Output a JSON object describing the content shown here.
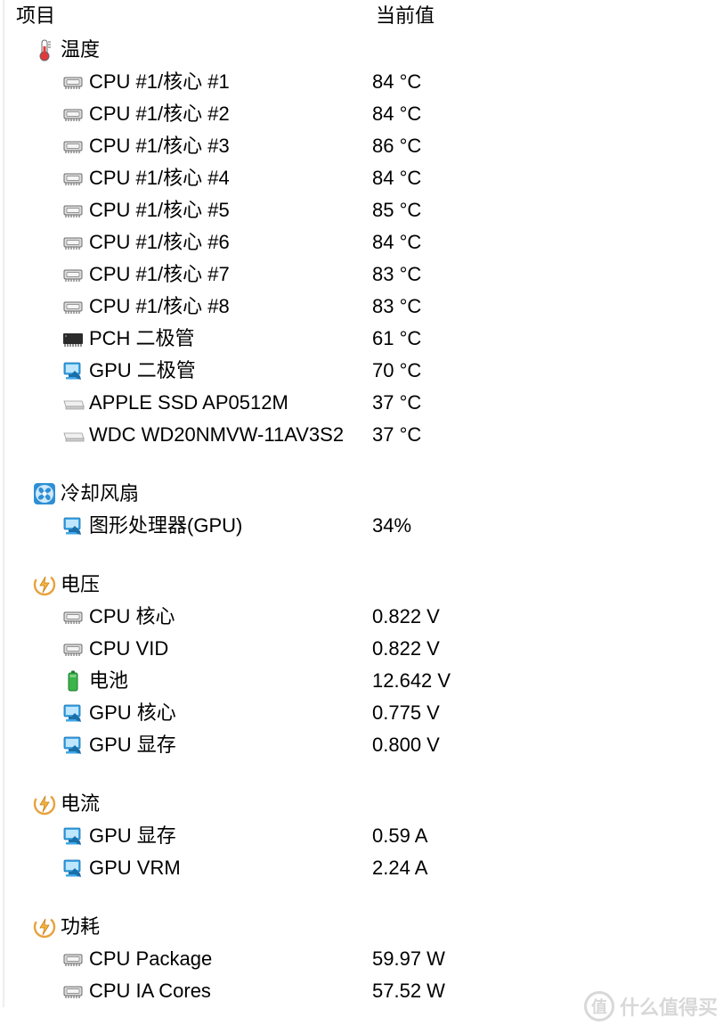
{
  "header": {
    "item": "项目",
    "value": "当前值"
  },
  "sections": [
    {
      "icon": "thermometer-icon",
      "title": "温度",
      "rows": [
        {
          "icon": "cpu-chip-icon",
          "label": "CPU #1/核心 #1",
          "value": "84 °C"
        },
        {
          "icon": "cpu-chip-icon",
          "label": "CPU #1/核心 #2",
          "value": "84 °C"
        },
        {
          "icon": "cpu-chip-icon",
          "label": "CPU #1/核心 #3",
          "value": "86 °C"
        },
        {
          "icon": "cpu-chip-icon",
          "label": "CPU #1/核心 #4",
          "value": "84 °C"
        },
        {
          "icon": "cpu-chip-icon",
          "label": "CPU #1/核心 #5",
          "value": "85 °C"
        },
        {
          "icon": "cpu-chip-icon",
          "label": "CPU #1/核心 #6",
          "value": "84 °C"
        },
        {
          "icon": "cpu-chip-icon",
          "label": "CPU #1/核心 #7",
          "value": "83 °C"
        },
        {
          "icon": "cpu-chip-icon",
          "label": "CPU #1/核心 #8",
          "value": "83 °C"
        },
        {
          "icon": "pch-chip-icon",
          "label": "PCH 二极管",
          "value": "61 °C"
        },
        {
          "icon": "gpu-monitor-icon",
          "label": "GPU 二极管",
          "value": "70 °C"
        },
        {
          "icon": "ssd-icon",
          "label": "APPLE SSD AP0512M",
          "value": "37 °C"
        },
        {
          "icon": "ssd-icon",
          "label": "WDC WD20NMVW-11AV3S2",
          "value": "37 °C"
        }
      ]
    },
    {
      "icon": "fan-icon",
      "title": "冷却风扇",
      "rows": [
        {
          "icon": "gpu-monitor-icon",
          "label": "图形处理器(GPU)",
          "value": "34%"
        }
      ]
    },
    {
      "icon": "bolt-icon",
      "title": "电压",
      "rows": [
        {
          "icon": "cpu-chip-icon",
          "label": "CPU 核心",
          "value": "0.822 V"
        },
        {
          "icon": "cpu-chip-icon",
          "label": "CPU VID",
          "value": "0.822 V"
        },
        {
          "icon": "battery-icon",
          "label": "电池",
          "value": "12.642 V"
        },
        {
          "icon": "gpu-monitor-icon",
          "label": "GPU 核心",
          "value": "0.775 V"
        },
        {
          "icon": "gpu-monitor-icon",
          "label": "GPU 显存",
          "value": "0.800 V"
        }
      ]
    },
    {
      "icon": "bolt-icon",
      "title": "电流",
      "rows": [
        {
          "icon": "gpu-monitor-icon",
          "label": "GPU 显存",
          "value": "0.59 A"
        },
        {
          "icon": "gpu-monitor-icon",
          "label": "GPU VRM",
          "value": "2.24 A"
        }
      ]
    },
    {
      "icon": "bolt-icon",
      "title": "功耗",
      "rows": [
        {
          "icon": "cpu-chip-icon",
          "label": "CPU Package",
          "value": "59.97 W"
        },
        {
          "icon": "cpu-chip-icon",
          "label": "CPU IA Cores",
          "value": "57.52 W"
        }
      ]
    }
  ],
  "watermark": "什么值得买"
}
